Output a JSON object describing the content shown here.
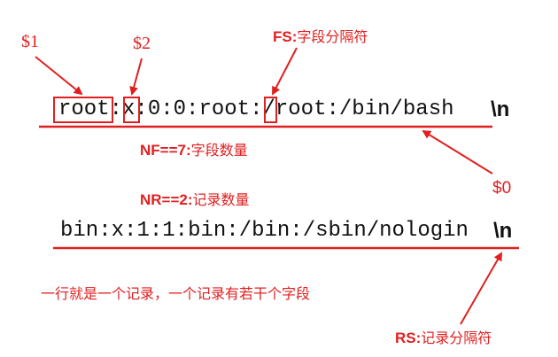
{
  "labels": {
    "field1": "$1",
    "field2": "$2",
    "fs": {
      "key": "FS:",
      "desc": "字段分隔符"
    },
    "record_ref": "$0",
    "nf": {
      "key": "NF==7:",
      "desc": "字段数量"
    },
    "nr": {
      "key": "NR==2:",
      "desc": "记录数量"
    },
    "rs": {
      "key": "RS:",
      "desc": "记录分隔符"
    },
    "summary": "一行就是一个记录，一个记录有若干个字段"
  },
  "records": [
    {
      "fields": [
        "root",
        "x",
        "0",
        "0",
        "root",
        "/root",
        "/bin/bash"
      ],
      "separator": ":",
      "terminator": "\\n"
    },
    {
      "fields": [
        "bin",
        "x",
        "1",
        "1",
        "bin",
        "/bin",
        "/sbin/nologin"
      ],
      "separator": ":",
      "terminator": "\\n"
    }
  ],
  "colors": {
    "annotation": "#e02020",
    "text": "#111111"
  }
}
